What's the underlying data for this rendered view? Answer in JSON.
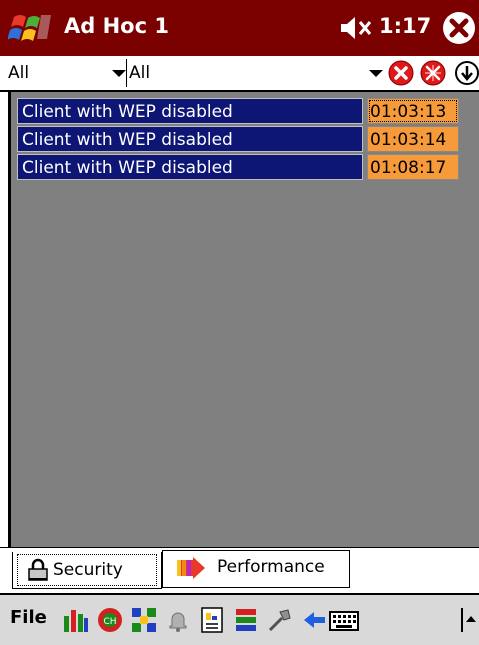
{
  "titlebar": {
    "title": "Ad Hoc 1",
    "time": "1:17",
    "start_icon": "windows-flag-icon",
    "volume_icon": "speaker-muted-icon",
    "close_icon": "close-icon"
  },
  "filters": {
    "category": "All",
    "type": "All"
  },
  "alerts": [
    {
      "message": "Client with WEP disabled",
      "time": "01:03:13"
    },
    {
      "message": "Client with WEP disabled",
      "time": "01:03:14"
    },
    {
      "message": "Client with WEP disabled",
      "time": "01:08:17"
    }
  ],
  "tabs": [
    {
      "label": "Security",
      "icon": "lock-icon",
      "active": true
    },
    {
      "label": "Performance",
      "icon": "performance-icon",
      "active": false
    }
  ],
  "menu": {
    "file": "File"
  },
  "colors": {
    "titlebar": "#7b0000",
    "list_bg": "#808080",
    "alert_bg": "#0d1675",
    "time_bg": "#f79a3a"
  }
}
